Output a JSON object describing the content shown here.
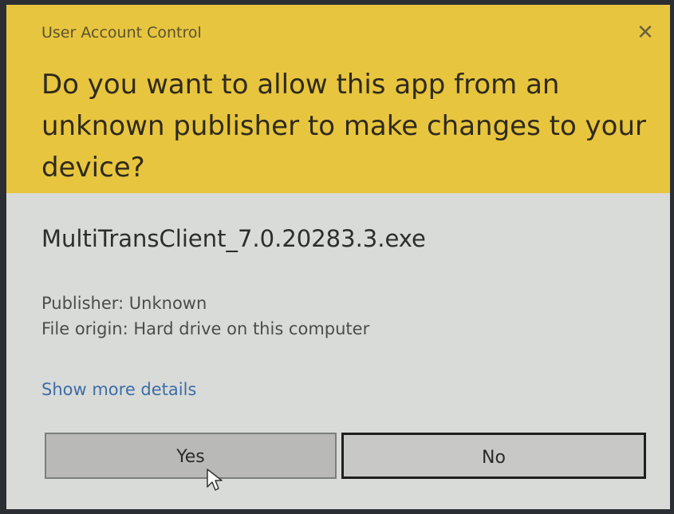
{
  "dialog": {
    "header_title": "User Account Control",
    "close_glyph": "✕",
    "question": "Do you want to allow this app from an unknown publisher to make changes to your device?",
    "app_name": "MultiTransClient_7.0.20283.3.exe",
    "publisher": "Publisher: Unknown",
    "file_origin": "File origin: Hard drive on this computer",
    "show_more_details": "Show more details",
    "yes_label": "Yes",
    "no_label": "No"
  },
  "colors": {
    "header_bg": "#e7c53e",
    "body_bg": "#d9dbd8",
    "link": "#3e6da6"
  },
  "icons": {
    "close": "close-icon",
    "cursor": "mouse-pointer-icon"
  }
}
